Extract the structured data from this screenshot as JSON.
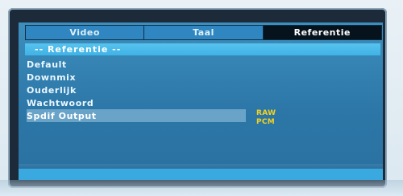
{
  "tabs": [
    {
      "label": "Video",
      "active": false
    },
    {
      "label": "Taal",
      "active": false
    },
    {
      "label": "Referentie",
      "active": true
    }
  ],
  "section_title": "-- Referentie --",
  "menu_items": [
    {
      "label": "Default"
    },
    {
      "label": "Downmix"
    },
    {
      "label": "Ouderlijk"
    },
    {
      "label": "Wachtwoord"
    },
    {
      "label": "Spdif Output",
      "selected": true
    }
  ],
  "spdif_options": [
    "RAW",
    "PCM"
  ],
  "colors": {
    "screen_bg": "#2c77a8",
    "active_tab_bg": "#06121c",
    "section_bar": "#3fb2e6",
    "option_text": "#f6d21e"
  }
}
